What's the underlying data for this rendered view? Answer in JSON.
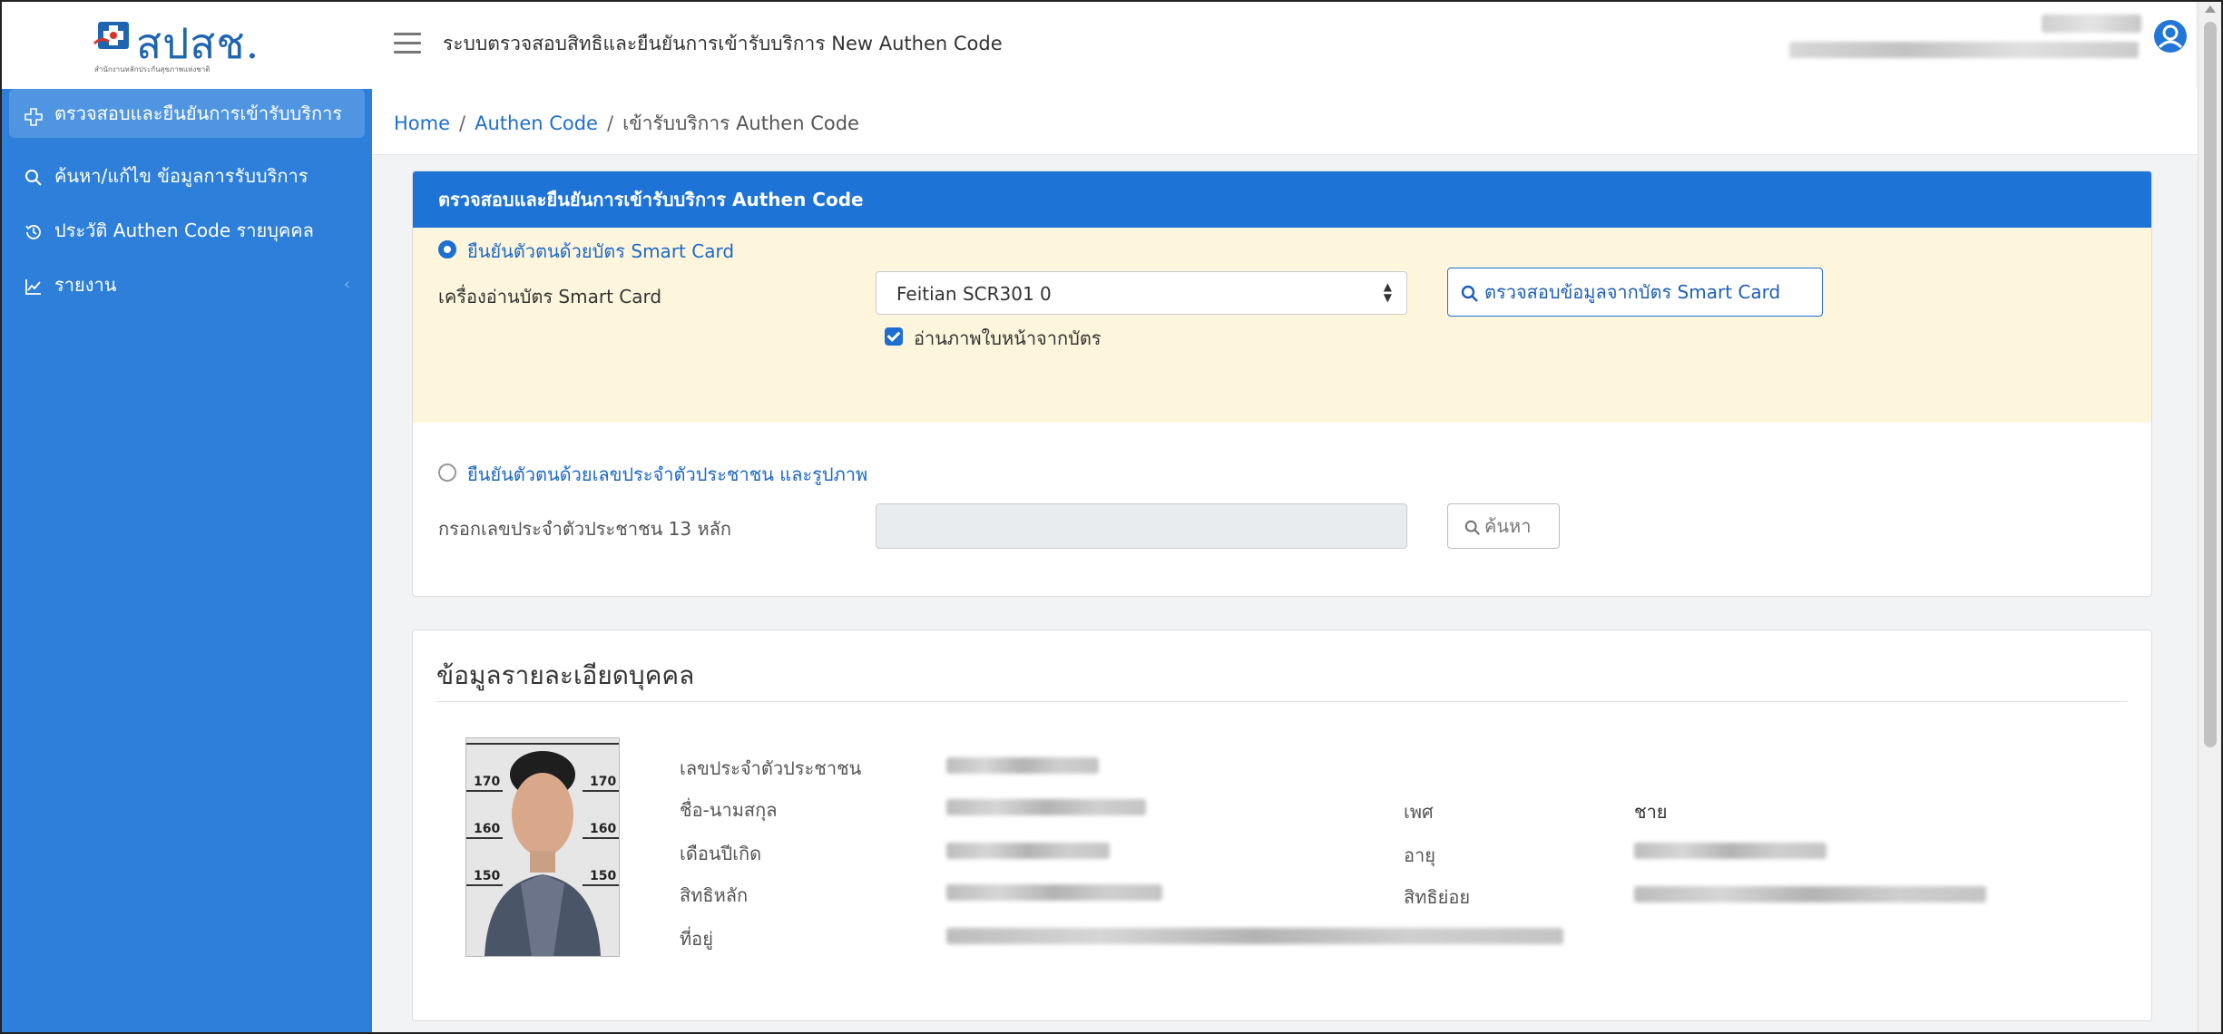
{
  "app": {
    "logo_text": "สปสช.",
    "logo_subtitle": "สำนักงานหลักประกันสุขภาพแห่งชาติ",
    "title": "ระบบตรวจสอบสิทธิและยืนยันการเข้ารับบริการ New Authen Code"
  },
  "sidebar": {
    "items": [
      {
        "label": "ตรวจสอบและยืนยันการเข้ารับบริการ",
        "icon": "plus-cross-icon",
        "active": true
      },
      {
        "label": "ค้นหา/แก้ไข ข้อมูลการรับบริการ",
        "icon": "search-icon"
      },
      {
        "label": "ประวัติ Authen Code รายบุคคล",
        "icon": "history-icon"
      },
      {
        "label": "รายงาน",
        "icon": "chart-line-icon",
        "has_submenu": true
      }
    ],
    "submenu_chevron": "‹"
  },
  "breadcrumb": {
    "home": "Home",
    "authen_code": "Authen Code",
    "current": "เข้ารับบริการ Authen Code",
    "separator": "/"
  },
  "verify_card": {
    "title": "ตรวจสอบและยืนยันการเข้ารับบริการ Authen Code",
    "smartcard_option": "ยืนยันตัวตนด้วยบัตร Smart Card",
    "reader_label": "เครื่องอ่านบัตร Smart Card",
    "reader_selected": "Feitian SCR301 0",
    "check_button": "ตรวจสอบข้อมูลจากบัตร Smart Card",
    "read_photo_label": "อ่านภาพใบหน้าจากบัตร",
    "read_photo_checked": true,
    "id_option": "ยืนยันตัวตนด้วยเลขประจำตัวประชาชน และรูปภาพ",
    "id_label": "กรอกเลขประจำตัวประชาชน 13 หลัก",
    "id_value": "",
    "search_button": "ค้นหา"
  },
  "person_card": {
    "title": "ข้อมูลรายละเอียดบุคคล",
    "labels": {
      "citizen_id": "เลขประจำตัวประชาชน",
      "fullname": "ชื่อ-นามสกุล",
      "birth_month_year": "เดือนปีเกิด",
      "main_right": "สิทธิหลัก",
      "address": "ที่อยู่",
      "gender": "เพศ",
      "age": "อายุ",
      "sub_right": "สิทธิย่อย"
    },
    "values": {
      "gender": "ชาย"
    },
    "photo_height_marks": [
      "170",
      "160",
      "150"
    ]
  },
  "colors": {
    "primary": "#1d73d6",
    "sidebar": "#2e7fd9",
    "sidebar_active": "#4f95e2",
    "smartcard_bg": "#fdf6dc"
  }
}
